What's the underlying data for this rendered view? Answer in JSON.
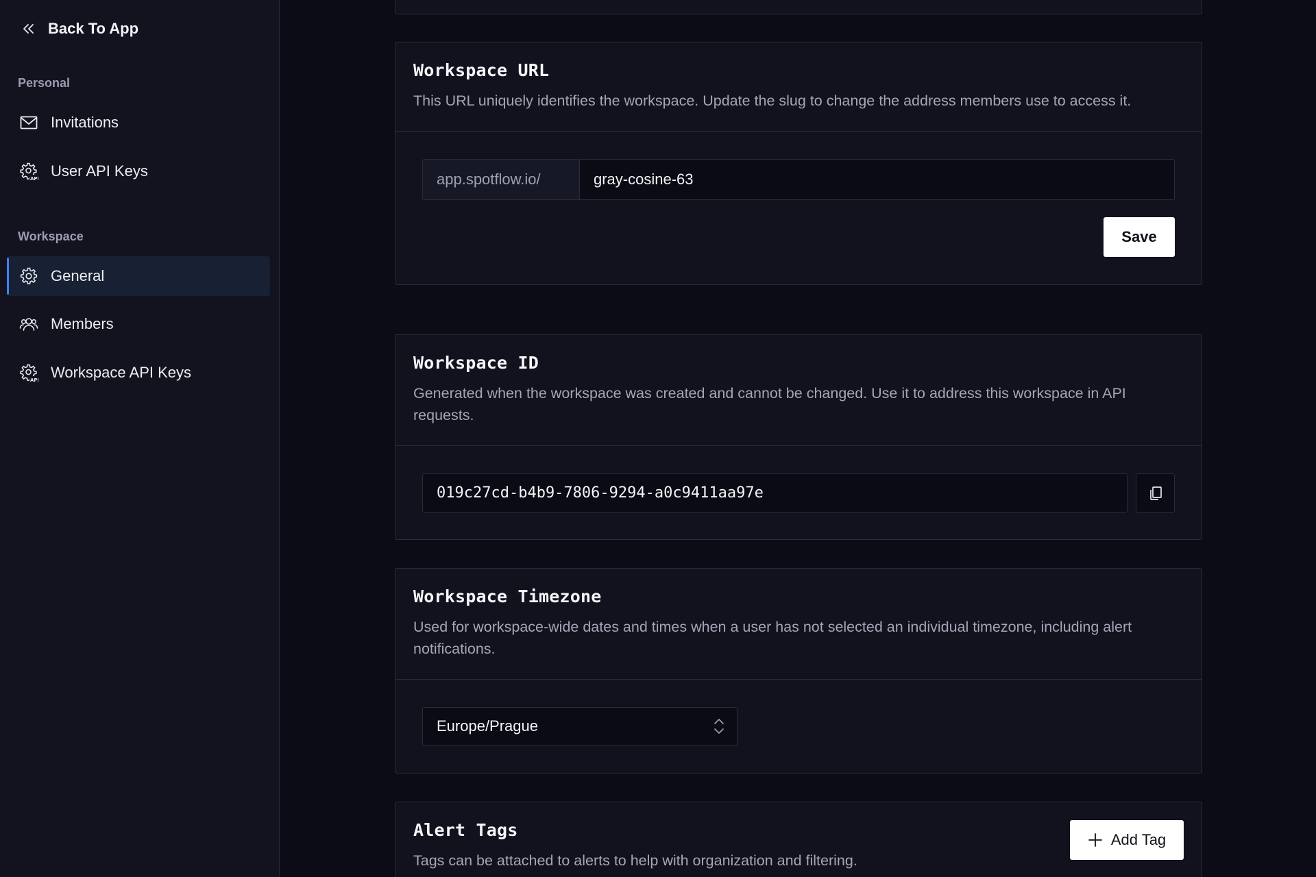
{
  "sidebar": {
    "back_label": "Back To App",
    "personal_label": "Personal",
    "personal_items": [
      {
        "label": "Invitations",
        "icon": "envelope-icon"
      },
      {
        "label": "User API Keys",
        "icon": "gear-api-icon"
      }
    ],
    "workspace_label": "Workspace",
    "workspace_items": [
      {
        "label": "General",
        "icon": "gear-icon",
        "active": true
      },
      {
        "label": "Members",
        "icon": "users-icon"
      },
      {
        "label": "Workspace API Keys",
        "icon": "gear-api-icon"
      }
    ]
  },
  "workspace_url": {
    "title": "Workspace URL",
    "description": "This URL uniquely identifies the workspace. Update the slug to change the address members use to access it.",
    "prefix": "app.spotflow.io/",
    "slug_value": "gray-cosine-63",
    "save_label": "Save"
  },
  "workspace_id": {
    "title": "Workspace ID",
    "description": "Generated when the workspace was created and cannot be changed. Use it to address this workspace in API requests.",
    "value": "019c27cd-b4b9-7806-9294-a0c9411aa97e"
  },
  "workspace_timezone": {
    "title": "Workspace Timezone",
    "description": "Used for workspace-wide dates and times when a user has not selected an individual timezone, including alert notifications.",
    "selected": "Europe/Prague"
  },
  "alert_tags": {
    "title": "Alert Tags",
    "description": "Tags can be attached to alerts to help with organization and filtering.",
    "add_label": "Add Tag"
  },
  "colors": {
    "background": "#0b0c16",
    "sidebar": "#12131f",
    "card": "#11121d",
    "border": "#2a2c3b",
    "accent": "#3b82f6",
    "muted_text": "#a3a6b8"
  }
}
